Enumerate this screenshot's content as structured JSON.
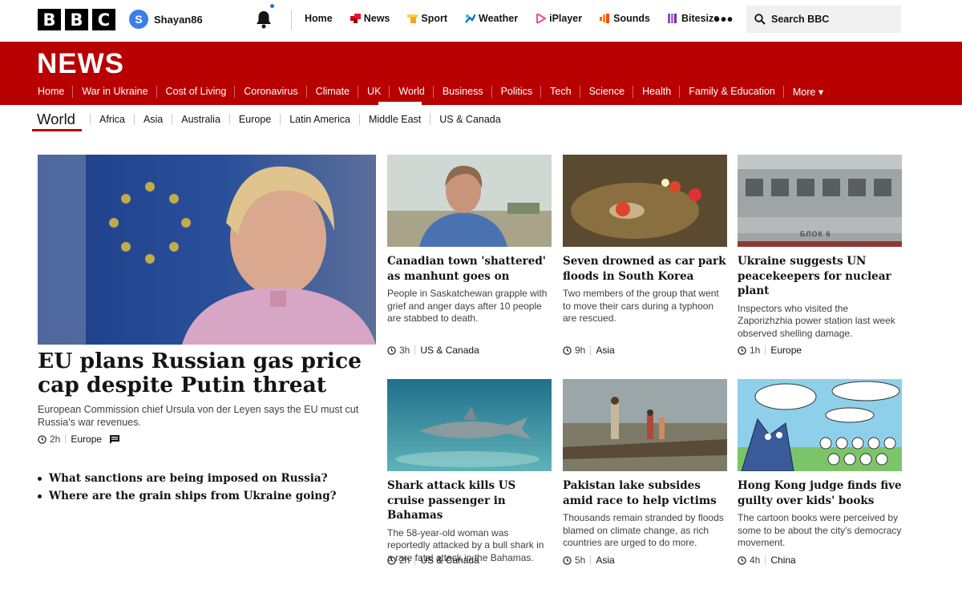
{
  "topbar": {
    "logo_letters": [
      "B",
      "B",
      "C"
    ],
    "account": {
      "initial": "S",
      "username": "Shayan86"
    },
    "nav": [
      {
        "label": "Home",
        "icon": ""
      },
      {
        "label": "News",
        "icon": "news-icon",
        "color": "#d0021b"
      },
      {
        "label": "Sport",
        "icon": "sport-icon",
        "color": "#ffd230"
      },
      {
        "label": "Weather",
        "icon": "weather-icon",
        "color": "#1a73b8"
      },
      {
        "label": "iPlayer",
        "icon": "iplayer-icon",
        "color": "#f54997"
      },
      {
        "label": "Sounds",
        "icon": "sounds-icon",
        "color": "#ff6600"
      },
      {
        "label": "Bitesize",
        "icon": "bitesize-icon",
        "color": "#8c4ec7"
      }
    ],
    "more": "•••",
    "search_label": "Search BBC"
  },
  "news": {
    "brand": "NEWS",
    "sections": [
      "Home",
      "War in Ukraine",
      "Cost of Living",
      "Coronavirus",
      "Climate",
      "UK",
      "World",
      "Business",
      "Politics",
      "Tech",
      "Science",
      "Health",
      "Family & Education",
      "More ▾"
    ],
    "active_section": "World"
  },
  "subnav": {
    "current": "World",
    "items": [
      "Africa",
      "Asia",
      "Australia",
      "Europe",
      "Latin America",
      "Middle East",
      "US & Canada"
    ]
  },
  "lead": {
    "title": "EU plans Russian gas price cap despite Putin threat",
    "summary": "European Commission chief Ursula von der Leyen says the EU must cut Russia's war revenues.",
    "age": "2h",
    "tag": "Europe",
    "related": [
      "What sanctions are being imposed on Russia?",
      "Where are the grain ships from Ukraine going?"
    ]
  },
  "cards": [
    {
      "title": "Canadian town 'shattered' as manhunt goes on",
      "summary": "People in Saskatchewan grapple with grief and anger days after 10 people are stabbed to death.",
      "age": "3h",
      "tag": "US & Canada"
    },
    {
      "title": "Seven drowned as car park floods in South Korea",
      "summary": "Two members of the group that went to move their cars during a typhoon are rescued.",
      "age": "9h",
      "tag": "Asia"
    },
    {
      "title": "Ukraine suggests UN peacekeepers for nuclear plant",
      "summary": "Inspectors who visited the Zaporizhzhia power station last week observed shelling damage.",
      "age": "1h",
      "tag": "Europe",
      "sign_text": "БЛОК 6"
    },
    {
      "title": "Shark attack kills US cruise passenger in Bahamas",
      "summary": "The 58-year-old woman was reportedly attacked by a bull shark in a rare fatal attack in the Bahamas.",
      "age": "2h",
      "tag": "US & Canada"
    },
    {
      "title": "Pakistan lake subsides amid race to help victims",
      "summary": "Thousands remain stranded by floods blamed on climate change, as rich countries are urged to do more.",
      "age": "5h",
      "tag": "Asia"
    },
    {
      "title": "Hong Kong judge finds five guilty over kids' books",
      "summary": "The cartoon books were perceived by some to be about the city's democracy movement.",
      "age": "4h",
      "tag": "China"
    }
  ],
  "colors": {
    "brand_red": "#b80000",
    "avatar_blue": "#3a7fe6"
  }
}
